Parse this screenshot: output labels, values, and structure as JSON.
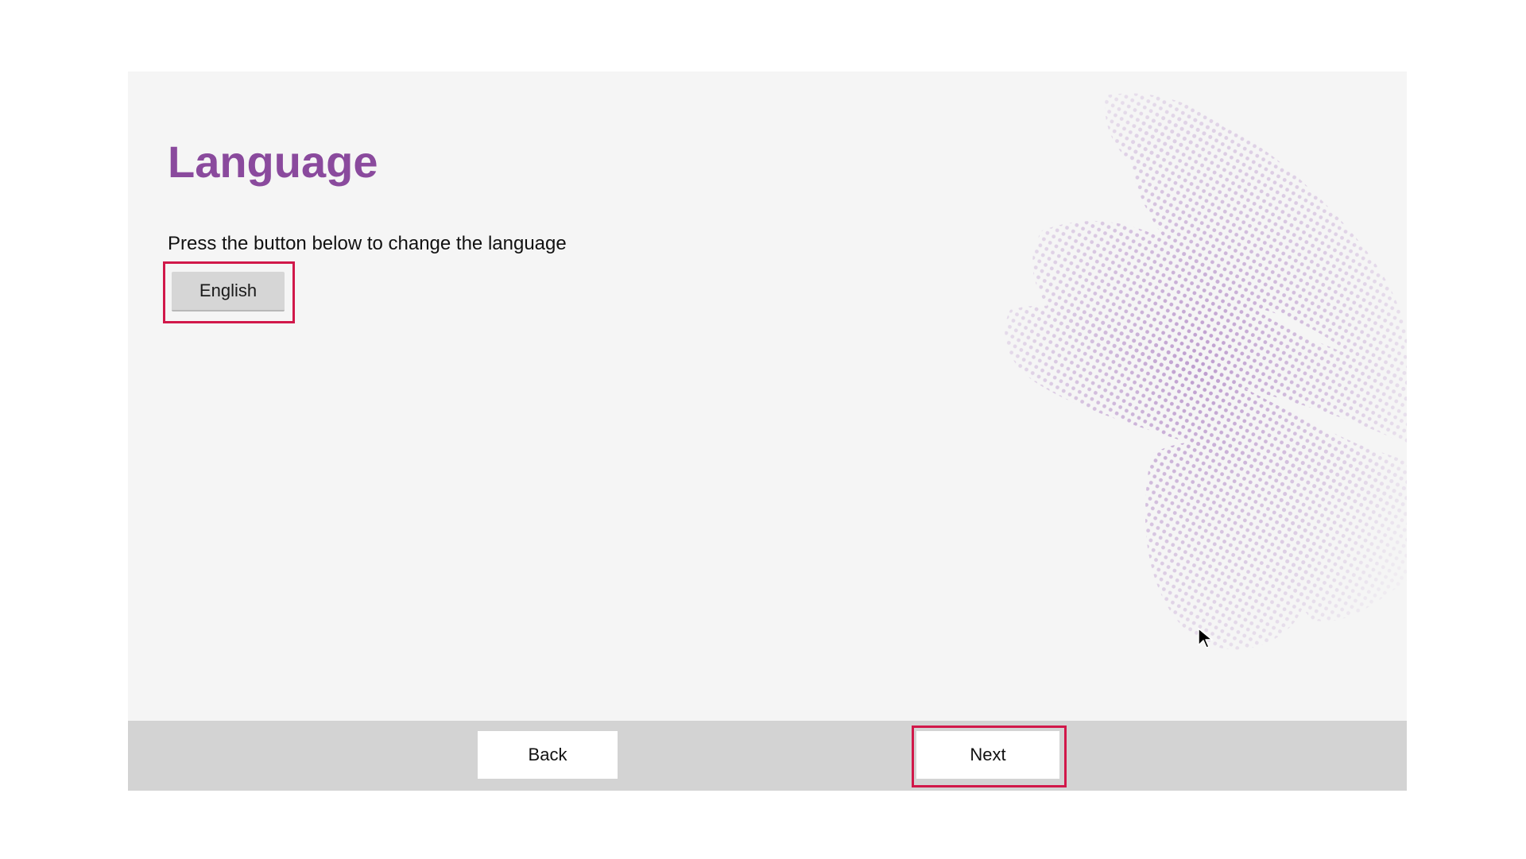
{
  "page": {
    "title": "Language",
    "subtitle": "Press the button below to change the language"
  },
  "language_button": {
    "label": "English"
  },
  "footer": {
    "back_label": "Back",
    "next_label": "Next"
  },
  "colors": {
    "title": "#8a4a9d",
    "highlight": "#d1184a",
    "background": "#f5f5f5",
    "footer": "#d3d3d3",
    "decor": "#b48cc8"
  },
  "icons": {
    "cursor": "mouse-pointer-icon",
    "decoration": "dotted-wave-decoration"
  }
}
